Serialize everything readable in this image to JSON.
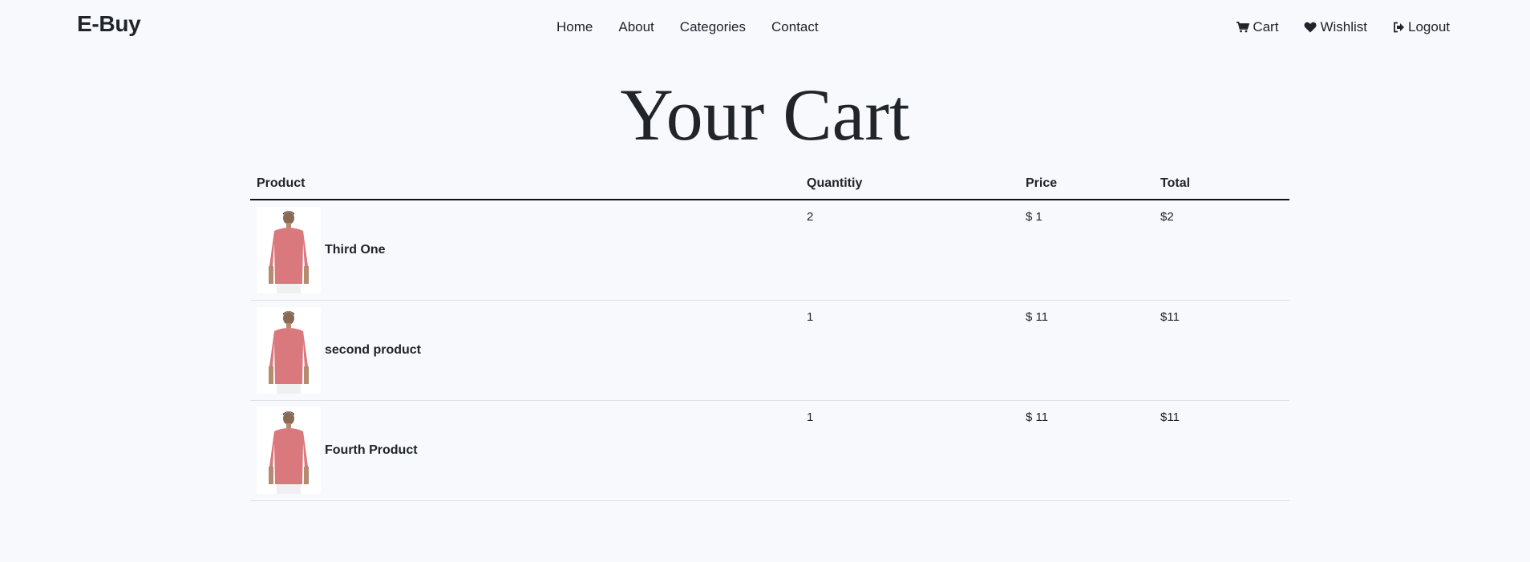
{
  "nav": {
    "brand": "E-Buy",
    "links": [
      "Home",
      "About",
      "Categories",
      "Contact"
    ],
    "cart": "Cart",
    "wishlist": "Wishlist",
    "logout": "Logout"
  },
  "page": {
    "title": "Your Cart"
  },
  "table": {
    "headers": {
      "product": "Product",
      "quantity": "Quantitiy",
      "price": "Price",
      "total": "Total"
    },
    "rows": [
      {
        "name": "Third One",
        "quantity": "2",
        "price": "$ 1",
        "total": "$2"
      },
      {
        "name": "second product",
        "quantity": "1",
        "price": "$ 11",
        "total": "$11"
      },
      {
        "name": "Fourth Product",
        "quantity": "1",
        "price": "$ 11",
        "total": "$11"
      }
    ]
  },
  "icons": {
    "cart": "cart-icon",
    "wishlist": "heart-icon",
    "logout": "logout-icon",
    "product": "shirt-model-icon"
  },
  "colors": {
    "background": "#f7f9fc",
    "text": "#212529",
    "shirt": "#d9787d"
  }
}
